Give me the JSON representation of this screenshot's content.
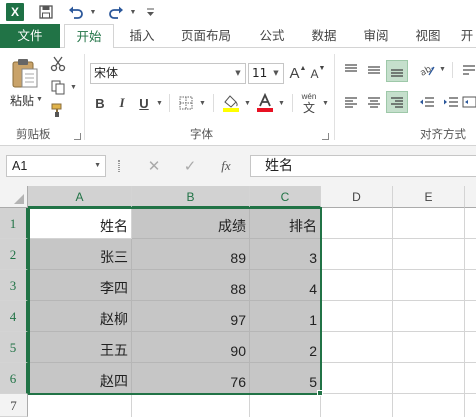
{
  "app": {
    "title": "Excel"
  },
  "qat": {
    "logo": "X"
  },
  "tabs": [
    {
      "label": "文件"
    },
    {
      "label": "开始"
    },
    {
      "label": "插入"
    },
    {
      "label": "页面布局"
    },
    {
      "label": "公式"
    },
    {
      "label": "数据"
    },
    {
      "label": "审阅"
    },
    {
      "label": "视图"
    },
    {
      "label": "开"
    }
  ],
  "ribbon": {
    "clipboard": {
      "label": "剪贴板",
      "paste_label": "粘贴"
    },
    "font": {
      "label": "字体",
      "font_name": "宋体",
      "font_size": "11",
      "bold": "B",
      "italic": "I",
      "underline": "U",
      "grow": "A",
      "shrink": "A",
      "wen": "wén",
      "wen_char": "文"
    },
    "alignment": {
      "label": "对齐方式"
    }
  },
  "formula_bar": {
    "name_box": "A1",
    "fx": "fx",
    "value": "姓名"
  },
  "grid": {
    "columns": [
      "A",
      "B",
      "C",
      "D",
      "E"
    ],
    "rows": [
      "1",
      "2",
      "3",
      "4",
      "5",
      "6",
      "7"
    ],
    "cells": [
      [
        "姓名",
        "成绩",
        "排名"
      ],
      [
        "张三",
        "89",
        "3"
      ],
      [
        "李四",
        "88",
        "4"
      ],
      [
        "赵柳",
        "97",
        "1"
      ],
      [
        "王五",
        "90",
        "2"
      ],
      [
        "赵四",
        "76",
        "5"
      ]
    ]
  },
  "colors": {
    "accent": "#217346",
    "selection": "#c6c6c6"
  }
}
